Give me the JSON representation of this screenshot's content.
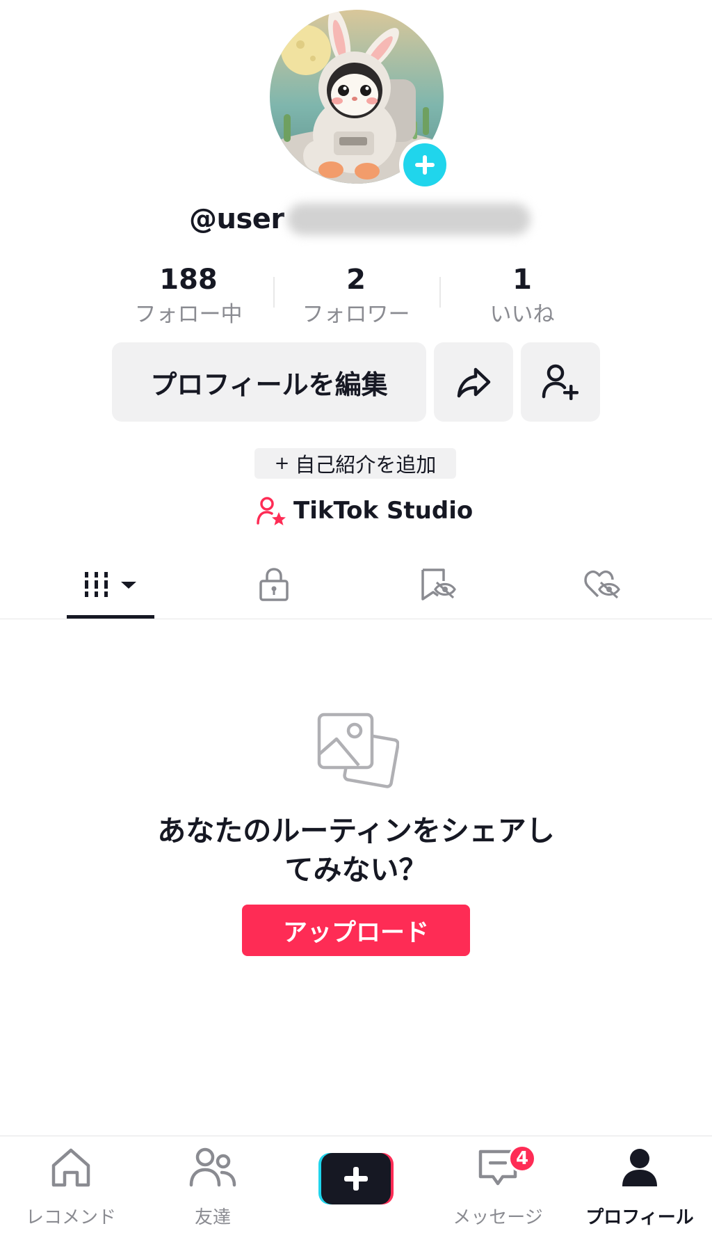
{
  "profile": {
    "username": "@user",
    "avatar_add_icon": "plus-circle-icon",
    "colors": {
      "accent": "#fe2c55",
      "avatar_add": "#20d5ec",
      "text": "#161823",
      "muted": "#8a8b91"
    }
  },
  "stats": [
    {
      "value": "188",
      "label": "フォロー中"
    },
    {
      "value": "2",
      "label": "フォロワー"
    },
    {
      "value": "1",
      "label": "いいね"
    }
  ],
  "actions": {
    "edit_profile": "プロフィールを編集",
    "share_icon": "share-arrow-icon",
    "add_friend_icon": "person-add-icon"
  },
  "bio": {
    "add_bio": "自己紹介を追加",
    "plus": "+"
  },
  "studio": {
    "label": "TikTok Studio",
    "icon": "creator-star-icon"
  },
  "tabs": [
    {
      "icon": "videos-grid-icon",
      "active": true
    },
    {
      "icon": "lock-icon",
      "active": false
    },
    {
      "icon": "saved-hidden-icon",
      "active": false
    },
    {
      "icon": "liked-hidden-icon",
      "active": false
    }
  ],
  "empty_state": {
    "icon": "photos-icon",
    "title_line1": "あなたのルーティンをシェアし",
    "title_line2": "てみない？",
    "upload_button": "アップロード"
  },
  "bottom_nav": [
    {
      "label": "レコメンド",
      "icon": "home-icon",
      "active": false
    },
    {
      "label": "友達",
      "icon": "friends-icon",
      "active": false
    },
    {
      "label": "",
      "icon": "create-plus-icon",
      "active": false
    },
    {
      "label": "メッセージ",
      "icon": "inbox-icon",
      "active": false,
      "badge": "4"
    },
    {
      "label": "プロフィール",
      "icon": "profile-icon",
      "active": true
    }
  ]
}
